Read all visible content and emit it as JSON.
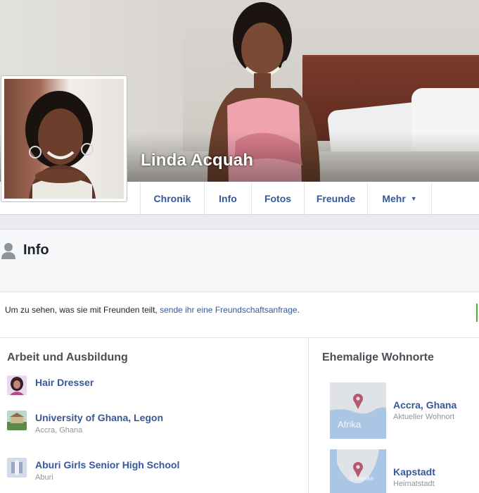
{
  "profile": {
    "name": "Linda Acquah"
  },
  "tabs": [
    {
      "label": "Chronik"
    },
    {
      "label": "Info"
    },
    {
      "label": "Fotos"
    },
    {
      "label": "Freunde"
    },
    {
      "label": "Mehr"
    }
  ],
  "info_header": {
    "title": "Info"
  },
  "notice": {
    "text": "Um zu sehen, was sie mit Freunden teilt, ",
    "link": "sende ihr eine Freundschaftsanfrage",
    "suffix": "."
  },
  "work": {
    "title": "Arbeit und Ausbildung",
    "items": [
      {
        "name": "Hair Dresser",
        "sub": ""
      },
      {
        "name": "University of Ghana, Legon",
        "sub": "Accra, Ghana"
      },
      {
        "name": "Aburi Girls Senior High School",
        "sub": "Aburi"
      }
    ]
  },
  "places": {
    "title": "Ehemalige Wohnorte",
    "items": [
      {
        "name": "Accra, Ghana",
        "sub": "Aktueller Wohnort",
        "map_label": "Afrika"
      },
      {
        "name": "Kapstadt",
        "sub": "Heimatstadt",
        "map_label": "Südafrika"
      }
    ]
  },
  "colors": {
    "link": "#365899",
    "map_pin": "#b45a6e",
    "map_water": "#a9c6e4",
    "map_land": "#dfe3e8"
  }
}
